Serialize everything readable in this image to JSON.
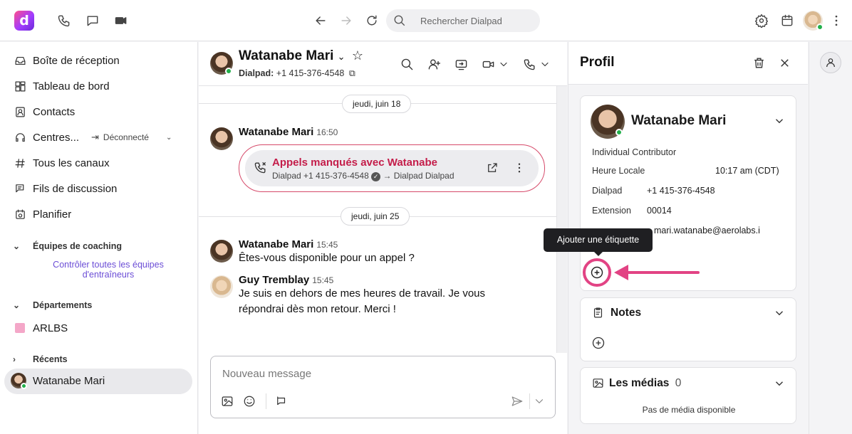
{
  "search": {
    "placeholder": "Rechercher Dialpad"
  },
  "sidebar": {
    "items": [
      {
        "label": "Boîte de réception",
        "icon": "inbox-icon"
      },
      {
        "label": "Tableau de bord",
        "icon": "dashboard-icon"
      },
      {
        "label": "Contacts",
        "icon": "contacts-icon"
      },
      {
        "label": "Centres...",
        "icon": "headset-icon"
      },
      {
        "label": "Tous les canaux",
        "icon": "hash-icon"
      },
      {
        "label": "Fils de discussion",
        "icon": "threads-icon"
      },
      {
        "label": "Planifier",
        "icon": "calendar-icon"
      }
    ],
    "status": "Déconnecté",
    "coaching": {
      "title": "Équipes de coaching",
      "link": "Contrôler toutes les équipes d'entraîneurs"
    },
    "departments": {
      "title": "Départements",
      "items": [
        {
          "label": "ARLBS",
          "color": "#f4a7c8"
        }
      ]
    },
    "recents": {
      "title": "Récents",
      "items": [
        {
          "label": "Watanabe Mari"
        }
      ]
    }
  },
  "conversation": {
    "name": "Watanabe Mari",
    "sub_label": "Dialpad:",
    "sub_number": "+1 415-376-4548",
    "days": [
      {
        "label": "jeudi, juin 18"
      },
      {
        "label": "jeudi, juin 25"
      }
    ],
    "messages": [
      {
        "author": "Watanabe Mari",
        "time": "16:50",
        "call": {
          "title": "Appels manqués avec Watanabe",
          "sub_left": "Dialpad +1 415-376-4548",
          "sub_right": "→ Dialpad Dialpad"
        }
      },
      {
        "author": "Watanabe Mari",
        "time": "15:45",
        "text": "Êtes-vous disponible pour un appel ?"
      },
      {
        "author": "Guy Tremblay",
        "time": "15:45",
        "text_line1": "Je suis en dehors de mes heures de travail. Je vous",
        "text_line2": "répondrai dès mon retour. Merci !"
      }
    ],
    "composer_placeholder": "Nouveau message"
  },
  "profile": {
    "title": "Profil",
    "name": "Watanabe Mari",
    "role": "Individual Contributor",
    "fields": [
      {
        "label": "Heure Locale",
        "value": "10:17 am (CDT)"
      },
      {
        "label": "Dialpad",
        "value": "+1 415-376-4548"
      },
      {
        "label": "Extension",
        "value": "00014"
      }
    ],
    "email_fragment": "mari.watanabe@aerolabs.i",
    "tooltip": "Ajouter une étiquette",
    "notes_title": "Notes",
    "media_title": "Les médias",
    "media_count": "0",
    "media_empty": "Pas de média disponible"
  },
  "colors": {
    "accent": "#6b4dd6",
    "highlight": "#e24384",
    "missed": "#c41d4a",
    "online": "#22b04b"
  }
}
